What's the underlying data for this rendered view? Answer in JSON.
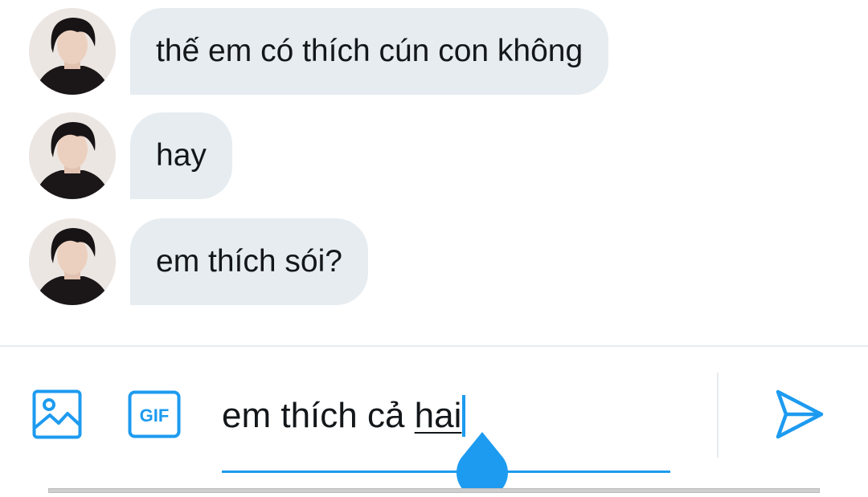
{
  "conversation": {
    "messages": [
      {
        "text": "thế em có thích cún con không",
        "avatar_icon": "user-avatar"
      },
      {
        "text": "hay",
        "avatar_icon": "user-avatar"
      },
      {
        "text": "em thích sói?",
        "avatar_icon": "user-avatar"
      }
    ]
  },
  "composer": {
    "text_before": "em thích cả ",
    "text_underlined": "hai",
    "gif_label": "GIF",
    "icons": {
      "image": "image-icon",
      "gif": "gif-icon",
      "send": "send-icon"
    }
  },
  "colors": {
    "accent": "#1d9bf0",
    "bubble": "#e6ecf0",
    "text": "#14171a",
    "divider": "#e6ecf0"
  }
}
